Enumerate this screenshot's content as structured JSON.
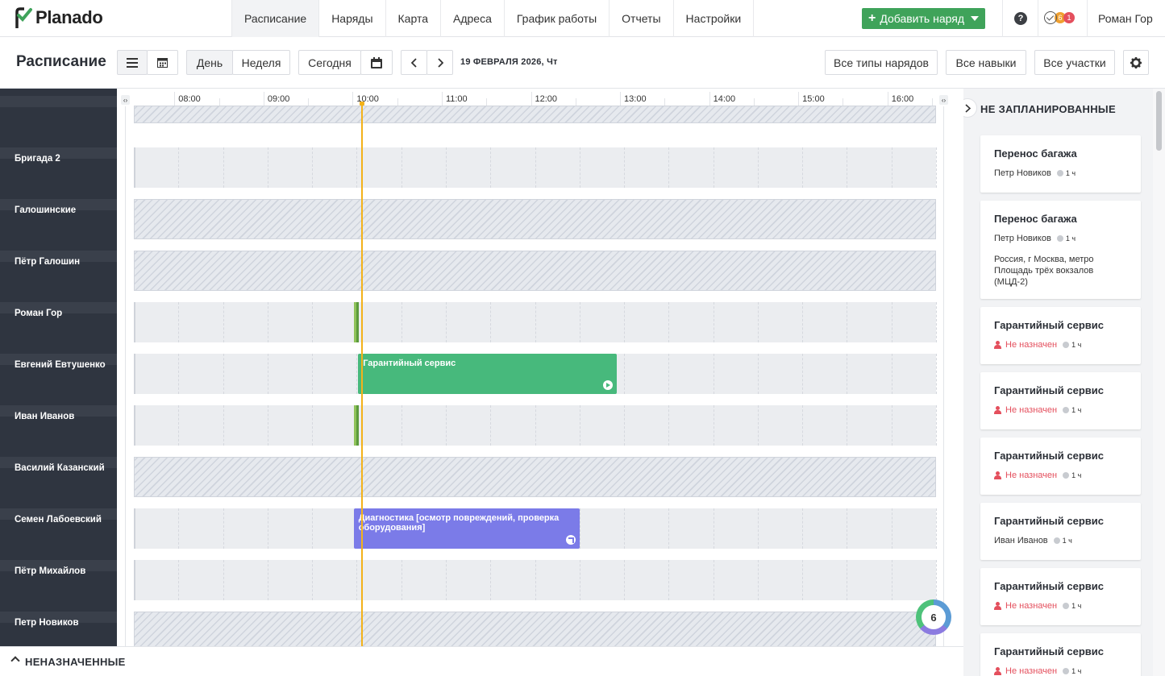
{
  "app": {
    "name": "Planado"
  },
  "nav": {
    "items": [
      "Расписание",
      "Наряды",
      "Карта",
      "Адреса",
      "График работы",
      "Отчеты",
      "Настройки"
    ],
    "active_index": 0
  },
  "header": {
    "add_button": "Добавить наряд",
    "help": "?",
    "status_badges": [
      "6",
      "1"
    ],
    "user": "Роман Гор"
  },
  "toolbar": {
    "title": "Расписание",
    "view_day": "День",
    "view_week": "Неделя",
    "today": "Сегодня",
    "date": "19 ФЕВРАЛЯ 2026, Чт",
    "filter_types": "Все типы нарядов",
    "filter_skills": "Все навыки",
    "filter_areas": "Все участки"
  },
  "timeline": {
    "hours": [
      "08:00",
      "09:00",
      "10:00",
      "11:00",
      "12:00",
      "13:00",
      "14:00",
      "15:00",
      "16:00"
    ],
    "start_hour": 7.5,
    "end_hour": 16.5,
    "now": "10:03",
    "total_count": "6"
  },
  "resources": [
    {
      "name": "",
      "off": true
    },
    {
      "name": "Бригада 2",
      "off": false
    },
    {
      "name": "Галошинские",
      "off": true
    },
    {
      "name": "Пётр Галошин",
      "off": true
    },
    {
      "name": "Роман Гор",
      "off": false
    },
    {
      "name": "Евгений Евтушенко",
      "off": false
    },
    {
      "name": "Иван Иванов",
      "off": false
    },
    {
      "name": "Василий Казанский",
      "off": true
    },
    {
      "name": "Семен Лабоевский",
      "off": false
    },
    {
      "name": "Пётр Михайлов",
      "off": false
    },
    {
      "name": "Петр Новиков",
      "off": true
    }
  ],
  "events": [
    {
      "lane": 4,
      "title": "",
      "start": "09:58",
      "end": "10:02",
      "kind": "mini",
      "color": "#5b9a3c"
    },
    {
      "lane": 5,
      "title": "Гарантийный сервис",
      "start": "10:01",
      "end": "12:55",
      "kind": "full",
      "color": "#47b97c",
      "icon": "play-icon"
    },
    {
      "lane": 6,
      "title": "",
      "start": "09:58",
      "end": "10:02",
      "kind": "mini",
      "color": "#5b9a3c"
    },
    {
      "lane": 8,
      "title": "Диагностика [осмотр повреждений, проверка оборудования]",
      "start": "09:58",
      "end": "12:30",
      "kind": "full",
      "color": "#7b7be8",
      "icon": "send-icon"
    }
  ],
  "unscheduled": {
    "title": "НЕ ЗАПЛАНИРОВАННЫЕ",
    "cards": [
      {
        "title": "Перенос багажа",
        "assignee": "Петр Новиков",
        "unassigned": false,
        "duration": "1 ч",
        "address": ""
      },
      {
        "title": "Перенос багажа",
        "assignee": "Петр Новиков",
        "unassigned": false,
        "duration": "1 ч",
        "address": "Россия, г Москва, метро Площадь трёх вокзалов (МЦД-2)"
      },
      {
        "title": "Гарантийный сервис",
        "assignee": "Не назначен",
        "unassigned": true,
        "duration": "1 ч",
        "address": ""
      },
      {
        "title": "Гарантийный сервис",
        "assignee": "Не назначен",
        "unassigned": true,
        "duration": "1 ч",
        "address": ""
      },
      {
        "title": "Гарантийный сервис",
        "assignee": "Не назначен",
        "unassigned": true,
        "duration": "1 ч",
        "address": ""
      },
      {
        "title": "Гарантийный сервис",
        "assignee": "Иван Иванов",
        "unassigned": false,
        "duration": "1 ч",
        "address": ""
      },
      {
        "title": "Гарантийный сервис",
        "assignee": "Не назначен",
        "unassigned": true,
        "duration": "1 ч",
        "address": ""
      },
      {
        "title": "Гарантийный сервис",
        "assignee": "Не назначен",
        "unassigned": true,
        "duration": "1 ч",
        "address": ""
      }
    ]
  },
  "bottom": {
    "label": "НЕНАЗНАЧЕННЫЕ"
  },
  "colors": {
    "accent": "#3fa35a",
    "sidebar": "#2f3540",
    "now_line": "#f3b21a",
    "unassigned": "#e44f5d",
    "badge_orange": "#f0a030",
    "badge_red": "#e44f5d"
  }
}
